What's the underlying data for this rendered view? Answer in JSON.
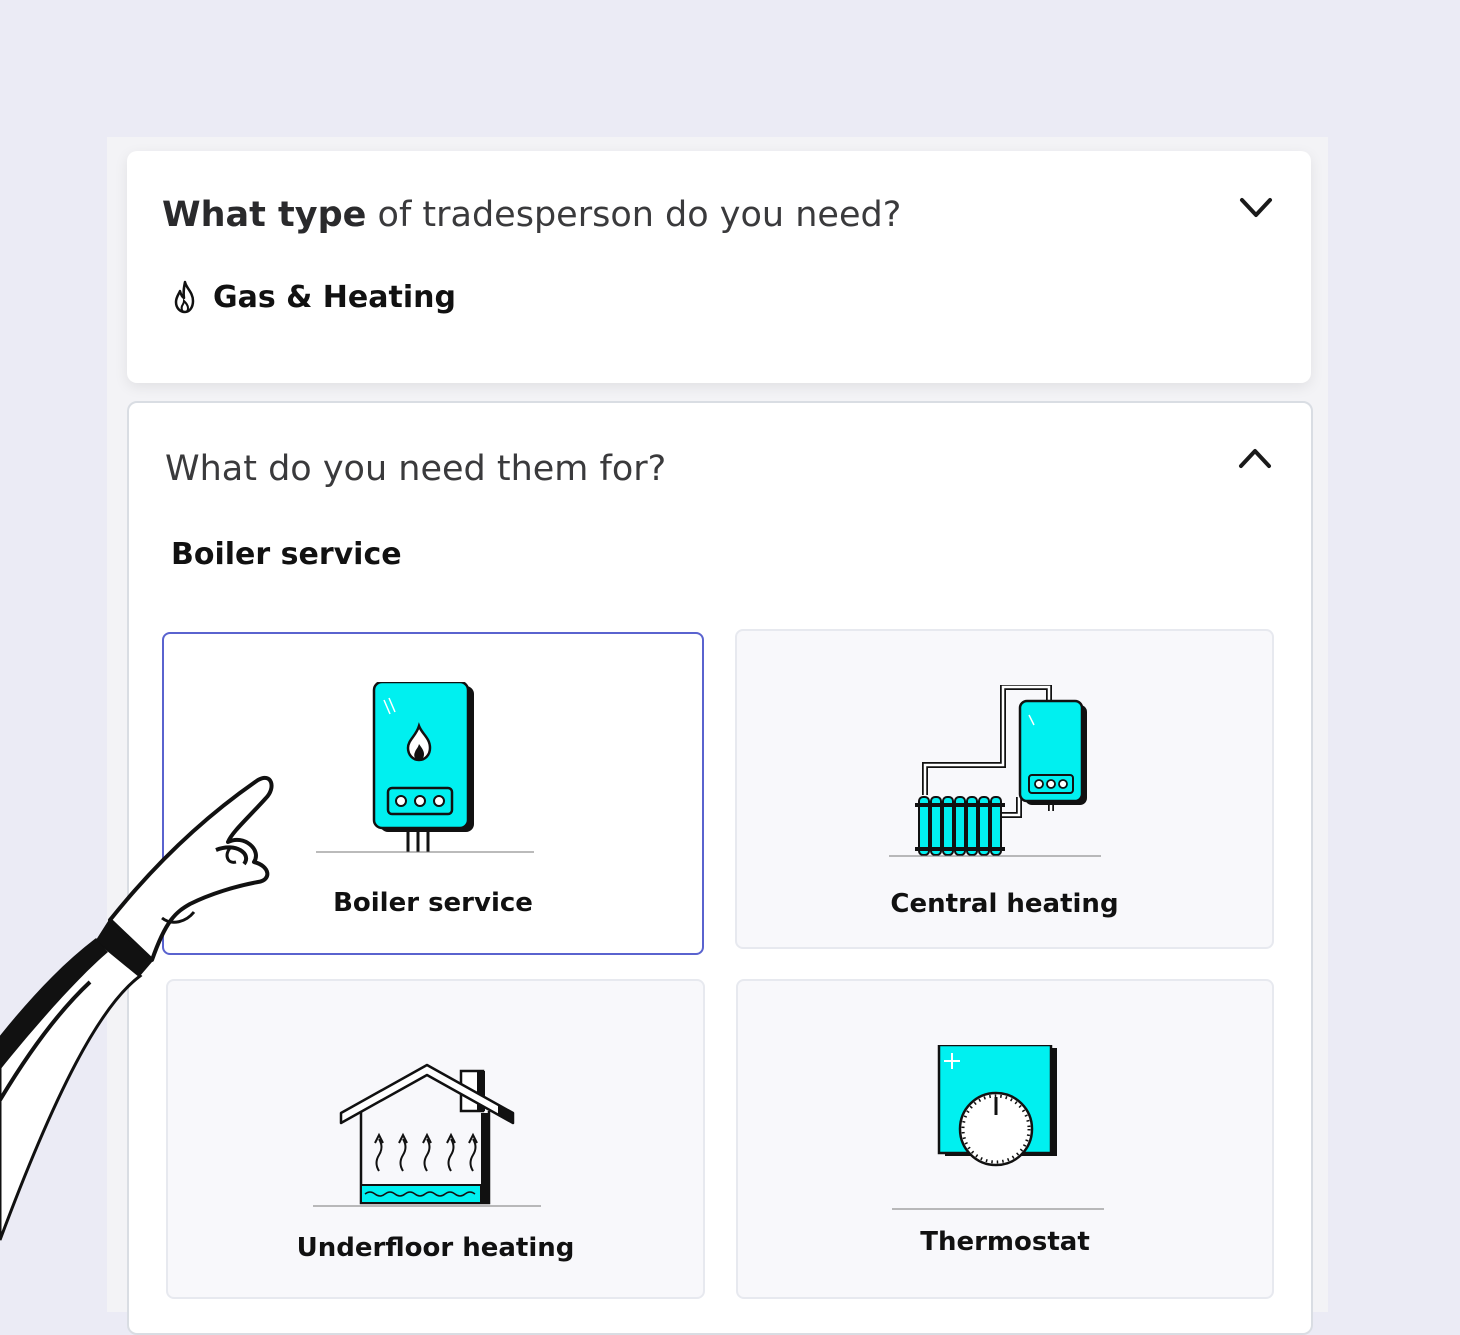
{
  "colors": {
    "background": "#ebebf5",
    "card": "#ffffff",
    "accent_cyan": "#00f0f0",
    "selected_border": "#5a63cf"
  },
  "question_trade": {
    "bold_part": "What type",
    "rest_part": " of tradesperson do you need?",
    "selected_icon": "flame-icon",
    "selected_value": "Gas & Heating",
    "toggle_icon": "chevron-down-icon"
  },
  "question_job": {
    "title": "What do you need them for?",
    "selected_value": "Boiler service",
    "toggle_icon": "chevron-up-icon",
    "options": [
      {
        "label": "Boiler service",
        "icon": "boiler-icon",
        "selected": true
      },
      {
        "label": "Central heating",
        "icon": "central-heating-icon",
        "selected": false
      },
      {
        "label": "Underfloor heating",
        "icon": "underfloor-heating-icon",
        "selected": false
      },
      {
        "label": "Thermostat",
        "icon": "thermostat-icon",
        "selected": false
      }
    ]
  }
}
